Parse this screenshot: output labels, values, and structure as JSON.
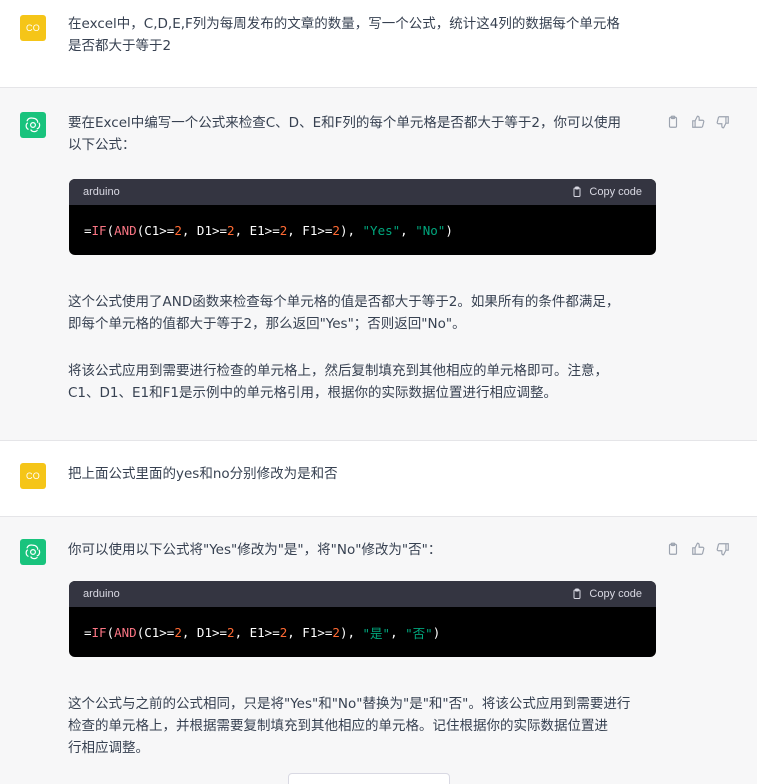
{
  "conversation": [
    {
      "role": "user",
      "avatar_text": "CO",
      "text_lines": [
        "在excel中，C,D,E,F列为每周发布的文章的数量，写一个公式，统计这4列的数据每个单元格",
        "是否都大于等于2"
      ]
    },
    {
      "role": "assistant",
      "intro_lines": [
        "要在Excel中编写一个公式来检查C、D、E和F列的每个单元格是否都大于等于2，你可以使用",
        "以下公式："
      ],
      "code": {
        "language": "arduino",
        "copy_label": "Copy code",
        "tokens": [
          {
            "t": "=",
            "c": "plain"
          },
          {
            "t": "IF",
            "c": "fn"
          },
          {
            "t": "(",
            "c": "plain"
          },
          {
            "t": "AND",
            "c": "fn"
          },
          {
            "t": "(C1>=",
            "c": "plain"
          },
          {
            "t": "2",
            "c": "num"
          },
          {
            "t": ", D1>=",
            "c": "plain"
          },
          {
            "t": "2",
            "c": "num"
          },
          {
            "t": ", E1>=",
            "c": "plain"
          },
          {
            "t": "2",
            "c": "num"
          },
          {
            "t": ", F1>=",
            "c": "plain"
          },
          {
            "t": "2",
            "c": "num"
          },
          {
            "t": "), ",
            "c": "plain"
          },
          {
            "t": "\"Yes\"",
            "c": "str"
          },
          {
            "t": ", ",
            "c": "plain"
          },
          {
            "t": "\"No\"",
            "c": "str"
          },
          {
            "t": ")",
            "c": "plain"
          }
        ]
      },
      "para1_lines": [
        "这个公式使用了AND函数来检查每个单元格的值是否都大于等于2。如果所有的条件都满足，",
        "即每个单元格的值都大于等于2，那么返回\"Yes\"；否则返回\"No\"。"
      ],
      "para2_lines": [
        "将该公式应用到需要进行检查的单元格上，然后复制填充到其他相应的单元格即可。注意，",
        "C1、D1、E1和F1是示例中的单元格引用，根据你的实际数据位置进行相应调整。"
      ]
    },
    {
      "role": "user",
      "avatar_text": "CO",
      "text_lines": [
        "把上面公式里面的yes和no分别修改为是和否"
      ]
    },
    {
      "role": "assistant",
      "intro_lines": [
        "你可以使用以下公式将\"Yes\"修改为\"是\"，将\"No\"修改为\"否\"："
      ],
      "code": {
        "language": "arduino",
        "copy_label": "Copy code",
        "tokens": [
          {
            "t": "=",
            "c": "plain"
          },
          {
            "t": "IF",
            "c": "fn"
          },
          {
            "t": "(",
            "c": "plain"
          },
          {
            "t": "AND",
            "c": "fn"
          },
          {
            "t": "(C1>=",
            "c": "plain"
          },
          {
            "t": "2",
            "c": "num"
          },
          {
            "t": ", D1>=",
            "c": "plain"
          },
          {
            "t": "2",
            "c": "num"
          },
          {
            "t": ", E1>=",
            "c": "plain"
          },
          {
            "t": "2",
            "c": "num"
          },
          {
            "t": ", F1>=",
            "c": "plain"
          },
          {
            "t": "2",
            "c": "num"
          },
          {
            "t": "), ",
            "c": "plain"
          },
          {
            "t": "\"是\"",
            "c": "str"
          },
          {
            "t": ", ",
            "c": "plain"
          },
          {
            "t": "\"否\"",
            "c": "str"
          },
          {
            "t": ")",
            "c": "plain"
          }
        ]
      },
      "para1_lines": [
        "这个公式与之前的公式相同，只是将\"Yes\"和\"No\"替换为\"是\"和\"否\"。将该公式应用到需要进行",
        "检查的单元格上，并根据需要复制填充到其他相应的单元格。记住根据你的实际数据位置进",
        "行相应调整。"
      ]
    }
  ],
  "icons": {
    "copy_message": "clipboard-icon",
    "thumbs_up": "thumbs-up-icon",
    "thumbs_down": "thumbs-down-icon",
    "copy_code": "clipboard-icon",
    "assistant_avatar": "openai-logo-icon"
  },
  "colors": {
    "user_avatar": "#f5c518",
    "assistant_avatar": "#19c37d",
    "assistant_bg": "#f7f7f8",
    "code_header": "#343541"
  }
}
